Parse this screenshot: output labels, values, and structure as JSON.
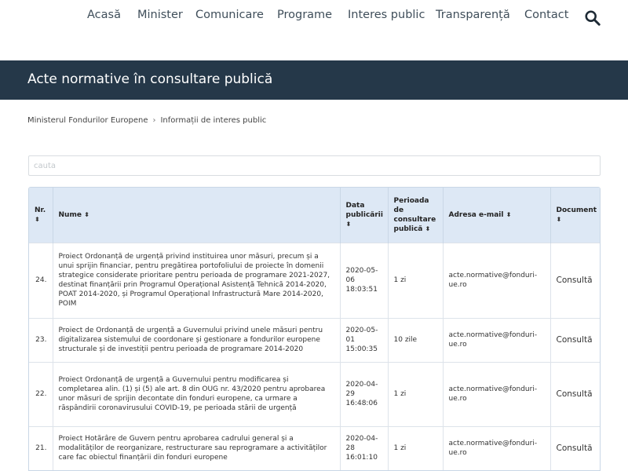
{
  "nav": {
    "items": [
      "Acasă",
      "Minister",
      "Comunicare",
      "Programe",
      "Interes public",
      "Transparență",
      "Contact"
    ]
  },
  "header": {
    "title": "Acte normative în consultare publică"
  },
  "breadcrumb": {
    "home": "Ministerul Fondurilor Europene",
    "separator": "›",
    "current": "Informații de interes public"
  },
  "search": {
    "placeholder": "cauta",
    "value": ""
  },
  "table": {
    "columns": {
      "nr": "Nr.",
      "name": "Nume",
      "date": "Data publicării",
      "period": "Perioada de consultare publică",
      "email": "Adresa e-mail",
      "document": "Document"
    },
    "sort_symbol": "⬍",
    "rows": [
      {
        "nr": "24.",
        "name": "Proiect Ordonanță de urgență privind instituirea unor măsuri, precum și a unui sprijin financiar, pentru pregătirea portofoliului de proiecte în domenii strategice considerate prioritare pentru perioada de programare 2021-2027, destinat finanțării prin Programul Operațional Asistență Tehnică 2014-2020, POAT 2014-2020, și Programul Operațional Infrastructură Mare 2014-2020, POIM",
        "date": "2020-05-06 18:03:51",
        "period": "1 zi",
        "email": "acte.normative@fonduri-ue.ro",
        "document": "Consultă"
      },
      {
        "nr": "23.",
        "name": "Proiect de Ordonanță de urgență a Guvernului privind unele măsuri pentru digitalizarea sistemului de coordonare și gestionare a fondurilor europene structurale și de investiții pentru perioada de programare 2014-2020",
        "date": "2020-05-01 15:00:35",
        "period": "10 zile",
        "email": "acte.normative@fonduri-ue.ro",
        "document": "Consultă"
      },
      {
        "nr": "22.",
        "name": "Proiect Ordonanță de urgență a Guvernului pentru modificarea și completarea alin. (1) și (5) ale art. 8 din OUG nr. 43/2020 pentru aprobarea unor măsuri de sprijin decontate din fonduri europene, ca urmare a răspândirii coronavirusului COVID-19, pe perioada stării de urgență",
        "date": "2020-04-29 16:48:06",
        "period": "1 zi",
        "email": "acte.normative@fonduri-ue.ro",
        "document": "Consultă"
      },
      {
        "nr": "21.",
        "name": "Proiect Hotărâre de Guvern pentru aprobarea cadrului general și a modalităților de reorganizare, restructurare sau reprogramare a activităților care fac obiectul finanțării din fonduri europene",
        "date": "2020-04-28 16:01:10",
        "period": "1 zi",
        "email": "acte.normative@fonduri-ue.ro",
        "document": "Consultă"
      }
    ]
  }
}
